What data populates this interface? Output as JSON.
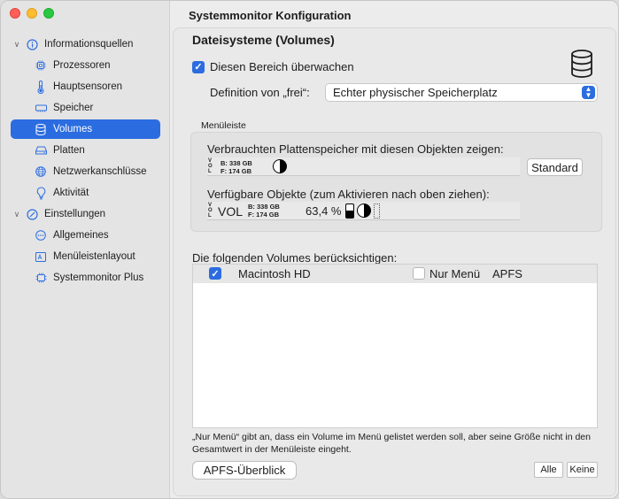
{
  "window": {
    "title": "Systemmonitor Konfiguration"
  },
  "sidebar": {
    "groups": [
      {
        "label": "Informationsquellen",
        "icon": "info-icon"
      },
      {
        "label": "Einstellungen",
        "icon": "settings-circle-icon"
      }
    ],
    "items": [
      {
        "label": "Prozessoren",
        "icon": "cpu-icon"
      },
      {
        "label": "Hauptsensoren",
        "icon": "thermometer-icon"
      },
      {
        "label": "Speicher",
        "icon": "memory-icon"
      },
      {
        "label": "Volumes",
        "icon": "database-icon",
        "selected": true
      },
      {
        "label": "Platten",
        "icon": "disk-icon"
      },
      {
        "label": "Netzwerkanschlüsse",
        "icon": "globe-icon"
      },
      {
        "label": "Aktivität",
        "icon": "lightbulb-icon"
      },
      {
        "label": "Allgemeines",
        "icon": "ellipsis-circle-icon"
      },
      {
        "label": "Menüleistenlayout",
        "icon": "menubar-icon"
      },
      {
        "label": "Systemmonitor Plus",
        "icon": "chip-icon"
      }
    ]
  },
  "main": {
    "section_title": "Dateisysteme (Volumes)",
    "monitor_checkbox": {
      "label": "Diesen Bereich überwachen",
      "checked": true
    },
    "free_definition": {
      "label": "Definition von „frei“:",
      "value": "Echter physischer Speicherplatz"
    },
    "menubar": {
      "title": "Menüleiste",
      "used_label": "Verbrauchten Plattenspeicher mit diesen Objekten zeigen:",
      "vol_vertical": "VOL",
      "b_value": "B: 338 GB",
      "f_value": "F: 174 GB",
      "standard_button": "Standard",
      "available_label": "Verfügbare Objekte (zum Aktivieren nach oben ziehen):",
      "vol_text": "VOL",
      "percent": "63,4 %"
    },
    "volumes": {
      "label": "Die folgenden Volumes berücksichtigen:",
      "rows": [
        {
          "checked": true,
          "name": "Macintosh HD",
          "menu_only_label": "Nur Menü",
          "menu_only_checked": false,
          "fs": "APFS"
        }
      ]
    },
    "note": "„Nur Menü“ gibt an, dass ein Volume im Menü gelistet werden soll, aber seine Größe nicht in den Gesamtwert in der Menüleiste eingeht.",
    "apfs_button": "APFS-Überblick",
    "all_button": "Alle",
    "none_button": "Keine"
  }
}
